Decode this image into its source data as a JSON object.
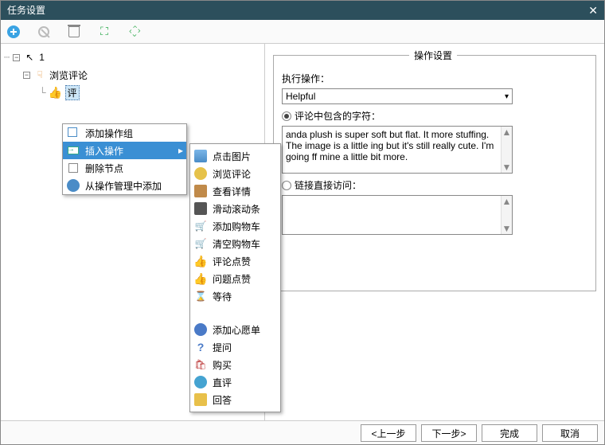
{
  "window": {
    "title": "任务设置"
  },
  "tree": {
    "root": "1",
    "child1": "浏览评论",
    "child2": "评"
  },
  "context_menu": {
    "items": [
      "添加操作组",
      "插入操作",
      "删除节点",
      "从操作管理中添加"
    ]
  },
  "submenu": {
    "items": [
      "点击图片",
      "浏览评论",
      "查看详情",
      "滑动滚动条",
      "添加购物车",
      "清空购物车",
      "评论点赞",
      "问题点赞",
      "等待",
      "添加心愿单",
      "提问",
      "购买",
      "直评",
      "回答"
    ]
  },
  "panel": {
    "legend": "操作设置",
    "exec_label": "执行操作：",
    "exec_value": "Helpful",
    "radio1_label": "评论中包含的字符：",
    "text1": "anda plush is super soft but flat. It more stuffing. The image is a little ing but it's still really cute. I'm going ff mine a little bit more.",
    "radio2_label": "链接直接访问："
  },
  "footer": {
    "prev": "<上一步",
    "next": "下一步>",
    "finish": "完成",
    "cancel": "取消"
  }
}
